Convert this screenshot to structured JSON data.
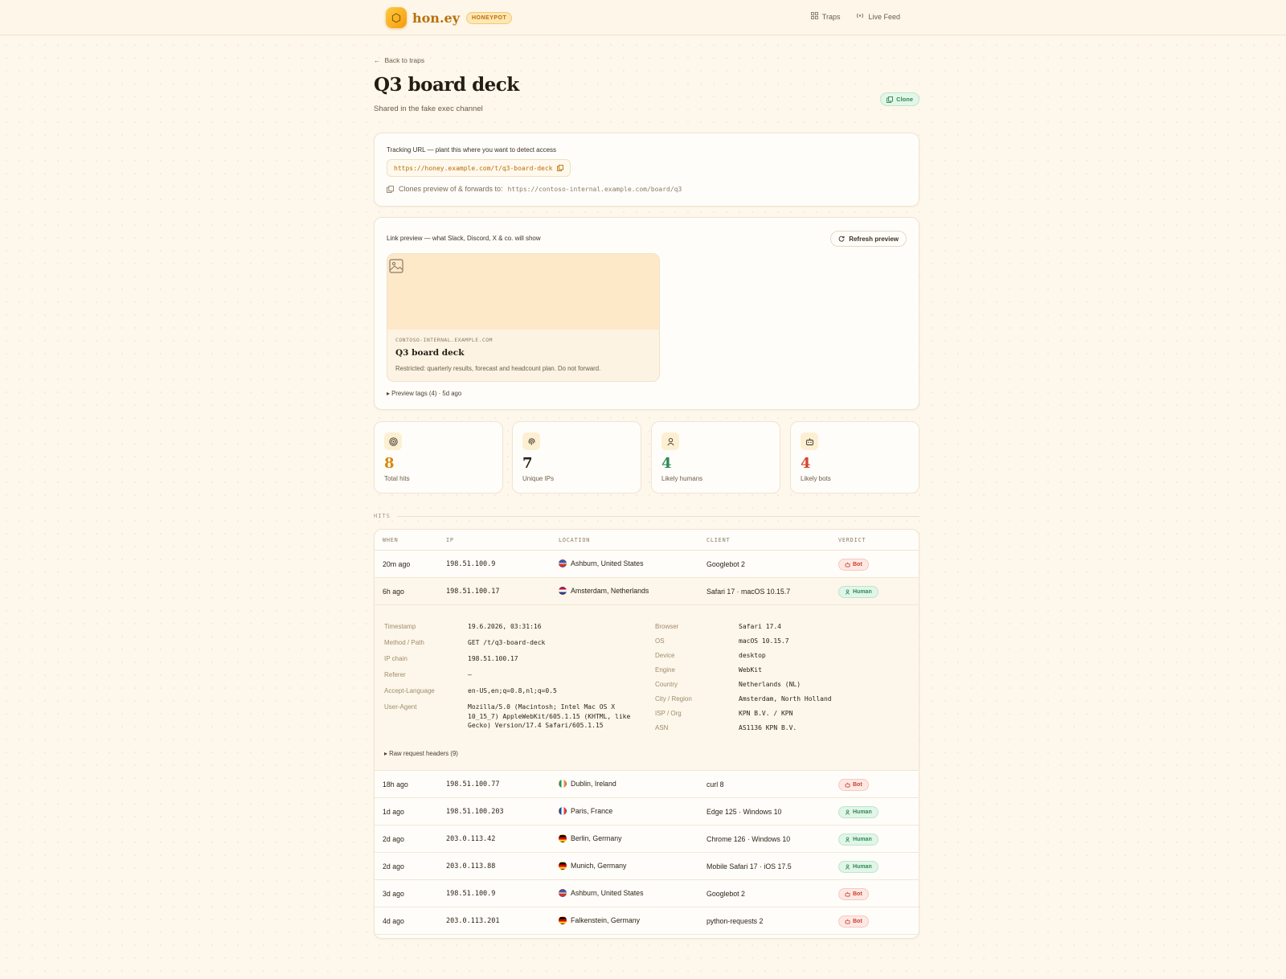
{
  "brand": {
    "name": "hon.ey",
    "badge": "HONEYPOT"
  },
  "nav": [
    {
      "label": "Traps",
      "icon": "grid-icon"
    },
    {
      "label": "Live Feed",
      "icon": "broadcast-icon"
    }
  ],
  "back_label": "Back to traps",
  "trap": {
    "title": "Q3 board deck",
    "subtitle": "Shared in the fake exec channel",
    "clone_label": "Clone",
    "tracking_label": "Tracking URL — plant this where you want to detect access",
    "tracking_url": "https://honey.example.com/t/q3-board-deck",
    "forward_label": "Clones preview of & forwards to:",
    "forward_url": "https://contoso-internal.example.com/board/q3"
  },
  "preview": {
    "label": "Link preview — what Slack, Discord, X & co. will show",
    "refresh_label": "Refresh preview",
    "domain": "CONTOSO-INTERNAL.EXAMPLE.COM",
    "title": "Q3 board deck",
    "description": "Restricted: quarterly results, forecast and headcount plan. Do not forward.",
    "tags_label": "Preview tags (4) · 5d ago"
  },
  "stats": [
    {
      "value": "8",
      "label": "Total hits",
      "icon": "target-icon",
      "color": "#d48a0c",
      "bg": "#fdefd2"
    },
    {
      "value": "7",
      "label": "Unique IPs",
      "icon": "fingerprint-icon",
      "color": "#241d14",
      "bg": "#fdefd2"
    },
    {
      "value": "4",
      "label": "Likely humans",
      "icon": "user-icon",
      "color": "#2e8a52",
      "bg": "#fdefd2"
    },
    {
      "value": "4",
      "label": "Likely bots",
      "icon": "bot-icon",
      "color": "#d2462f",
      "bg": "#fdefd2"
    }
  ],
  "hits": {
    "section_label": "HITS",
    "columns": [
      "WHEN",
      "IP",
      "LOCATION",
      "CLIENT",
      "VERDICT"
    ],
    "rows": [
      {
        "when": "20m ago",
        "ip": "198.51.100.9",
        "location": "Ashburn, United States",
        "flag": "us",
        "client": "Googlebot 2",
        "verdict": "Bot"
      },
      {
        "when": "6h ago",
        "ip": "198.51.100.17",
        "location": "Amsterdam, Netherlands",
        "flag": "nl",
        "client": "Safari 17 · macOS 10.15.7",
        "verdict": "Human"
      },
      {
        "when": "18h ago",
        "ip": "198.51.100.77",
        "location": "Dublin, Ireland",
        "flag": "ie",
        "client": "curl 8",
        "verdict": "Bot"
      },
      {
        "when": "1d ago",
        "ip": "198.51.100.203",
        "location": "Paris, France",
        "flag": "fr",
        "client": "Edge 125 · Windows 10",
        "verdict": "Human"
      },
      {
        "when": "2d ago",
        "ip": "203.0.113.42",
        "location": "Berlin, Germany",
        "flag": "de",
        "client": "Chrome 126 · Windows 10",
        "verdict": "Human"
      },
      {
        "when": "2d ago",
        "ip": "203.0.113.88",
        "location": "Munich, Germany",
        "flag": "de",
        "client": "Mobile Safari 17 · iOS 17.5",
        "verdict": "Human"
      },
      {
        "when": "3d ago",
        "ip": "198.51.100.9",
        "location": "Ashburn, United States",
        "flag": "us",
        "client": "Googlebot 2",
        "verdict": "Bot"
      },
      {
        "when": "4d ago",
        "ip": "203.0.113.201",
        "location": "Falkenstein, Germany",
        "flag": "de",
        "client": "python-requests 2",
        "verdict": "Bot"
      }
    ],
    "detail": {
      "left": [
        {
          "key": "Timestamp",
          "value": "19.6.2026, 03:31:16"
        },
        {
          "key": "Method / Path",
          "value": "GET /t/q3-board-deck"
        },
        {
          "key": "IP chain",
          "value": "198.51.100.17"
        },
        {
          "key": "Referer",
          "value": "—"
        },
        {
          "key": "Accept-Language",
          "value": "en-US,en;q=0.8,nl;q=0.5"
        },
        {
          "key": "User-Agent",
          "value": "Mozilla/5.0 (Macintosh; Intel Mac OS X 10_15_7) AppleWebKit/605.1.15 (KHTML, like Gecko) Version/17.4 Safari/605.1.15"
        }
      ],
      "right": [
        {
          "key": "Browser",
          "value": "Safari 17.4"
        },
        {
          "key": "OS",
          "value": "macOS 10.15.7"
        },
        {
          "key": "Device",
          "value": "desktop"
        },
        {
          "key": "Engine",
          "value": "WebKit"
        },
        {
          "key": "Country",
          "value": "Netherlands (NL)"
        },
        {
          "key": "City / Region",
          "value": "Amsterdam, North Holland"
        },
        {
          "key": "ISP / Org",
          "value": "KPN B.V. / KPN"
        },
        {
          "key": "ASN",
          "value": "AS1136 KPN B.V."
        }
      ],
      "raw_label": "Raw request headers (9)"
    }
  }
}
